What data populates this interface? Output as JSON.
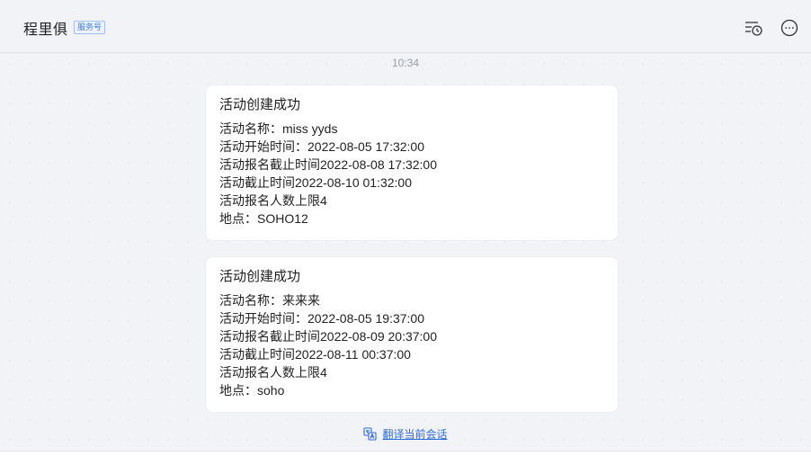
{
  "header": {
    "title": "程里俱",
    "badge": "服务号",
    "icons": [
      "history-icon",
      "more-icon"
    ]
  },
  "chat": {
    "timestamp": "10:34",
    "messages": [
      {
        "title": "活动创建成功",
        "lines": [
          "活动名称：miss yyds",
          "活动开始时间：2022-08-05 17:32:00",
          "活动报名截止时间2022-08-08 17:32:00",
          "活动截止时间2022-08-10 01:32:00",
          "活动报名人数上限4",
          "地点：SOHO12"
        ]
      },
      {
        "title": "活动创建成功",
        "lines": [
          "活动名称：来来来",
          "活动开始时间：2022-08-05 19:37:00",
          "活动报名截止时间2022-08-09 20:37:00",
          "活动截止时间2022-08-11 00:37:00",
          "活动报名人数上限4",
          "地点：soho"
        ]
      }
    ],
    "translate_label": "翻译当前会话"
  },
  "colors": {
    "accent": "#2f6bd8",
    "badge": "#3d7be0",
    "background": "#f1f3f6"
  }
}
